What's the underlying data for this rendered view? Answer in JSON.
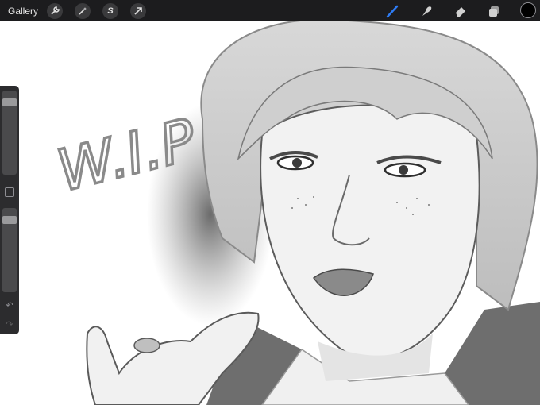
{
  "toolbar": {
    "gallery_label": "Gallery",
    "left_tools": [
      {
        "name": "actions",
        "icon": "wrench-icon"
      },
      {
        "name": "adjustments",
        "icon": "magic-wand-icon"
      },
      {
        "name": "selection",
        "icon": "selection-s-icon",
        "glyph": "S"
      },
      {
        "name": "transform",
        "icon": "arrow-cursor-icon"
      }
    ],
    "right_tools": [
      {
        "name": "brush",
        "icon": "brush-icon",
        "active": true
      },
      {
        "name": "smudge",
        "icon": "smudge-icon"
      },
      {
        "name": "eraser",
        "icon": "eraser-icon"
      },
      {
        "name": "layers",
        "icon": "layers-icon"
      }
    ],
    "active_color": "#000000",
    "accent_color": "#2e7cf6"
  },
  "sidebar": {
    "brush_size_level": 0.1,
    "opacity_level": 0.1,
    "undo_icon": "undo-icon",
    "redo_icon": "redo-icon"
  },
  "canvas": {
    "annotation_text": "W.I.P"
  }
}
